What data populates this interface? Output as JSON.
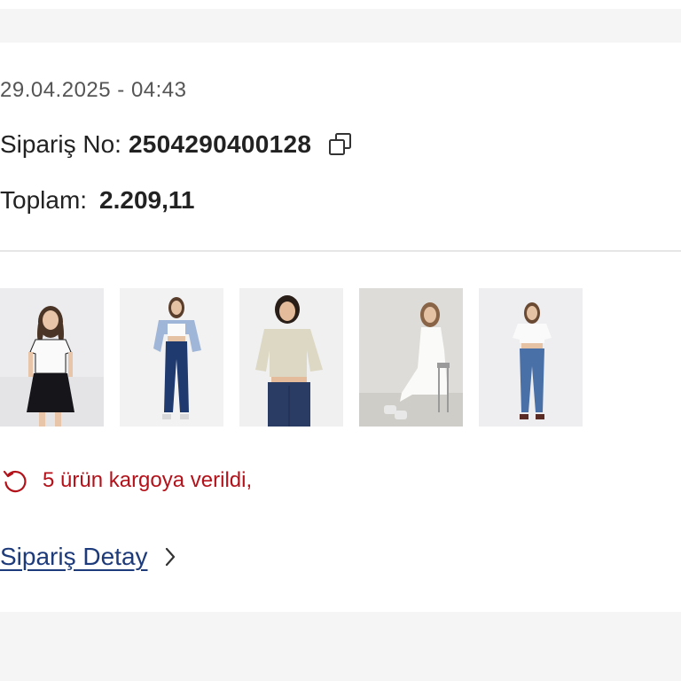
{
  "order": {
    "date": "29.04.2025 - 04:43",
    "number_label": "Sipariş No:",
    "number": "2504290400128",
    "total_label": "Toplam:",
    "total_value": "2.209,11"
  },
  "products": [
    {
      "name": "product-1",
      "desc": "white crop tee with black pleated skirt"
    },
    {
      "name": "product-2",
      "desc": "blue denim shirt with flare jeans"
    },
    {
      "name": "product-3",
      "desc": "beige short-sleeve shirt with jeans"
    },
    {
      "name": "product-4",
      "desc": "white sleeveless dress"
    },
    {
      "name": "product-5",
      "desc": "white tee with flare jeans"
    }
  ],
  "status": {
    "text": "5 ürün kargoya verildi,",
    "color": "#b3121a",
    "icon": "refresh-icon"
  },
  "detail": {
    "link_label": "Sipariş Detay",
    "link_color": "#1d3a7a",
    "icon": "chevron-right-icon"
  },
  "icons": {
    "copy": "copy-icon"
  }
}
